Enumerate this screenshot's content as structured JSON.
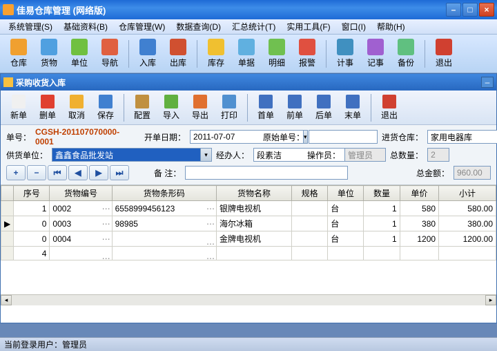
{
  "window": {
    "title": "佳易仓库管理 (网络版)"
  },
  "menu": [
    "系统管理(S)",
    "基础资料(B)",
    "仓库管理(W)",
    "数据查询(D)",
    "汇总统计(T)",
    "实用工具(F)",
    "窗口(I)",
    "帮助(H)"
  ],
  "main_toolbar": [
    {
      "label": "仓库",
      "color": "#f0a030"
    },
    {
      "label": "货物",
      "color": "#50a0e0"
    },
    {
      "label": "单位",
      "color": "#70c040"
    },
    {
      "label": "导航",
      "color": "#e06040"
    },
    {
      "label": "入库",
      "color": "#4080d0",
      "sep_before": true
    },
    {
      "label": "出库",
      "color": "#d05030"
    },
    {
      "label": "库存",
      "color": "#f0c030",
      "sep_before": true
    },
    {
      "label": "单据",
      "color": "#60b0e0"
    },
    {
      "label": "明细",
      "color": "#70c050"
    },
    {
      "label": "报警",
      "color": "#e05040"
    },
    {
      "label": "计事",
      "color": "#4090c0",
      "sep_before": true
    },
    {
      "label": "记事",
      "color": "#a060d0"
    },
    {
      "label": "备份",
      "color": "#60c080"
    },
    {
      "label": "退出",
      "color": "#d04030",
      "sep_before": true
    }
  ],
  "child": {
    "title": "采购收货入库",
    "toolbar": [
      {
        "label": "新单",
        "color": "#f0f0f0"
      },
      {
        "label": "删单",
        "color": "#e04030"
      },
      {
        "label": "取消",
        "color": "#f0b030"
      },
      {
        "label": "保存",
        "color": "#4080d0"
      },
      {
        "label": "配置",
        "color": "#c09040",
        "sep_before": true
      },
      {
        "label": "导入",
        "color": "#60b040"
      },
      {
        "label": "导出",
        "color": "#e07030"
      },
      {
        "label": "打印",
        "color": "#5090d0"
      },
      {
        "label": "首单",
        "color": "#4070c0",
        "sep_before": true
      },
      {
        "label": "前单",
        "color": "#4070c0"
      },
      {
        "label": "后单",
        "color": "#4070c0"
      },
      {
        "label": "末单",
        "color": "#4070c0"
      },
      {
        "label": "退出",
        "color": "#d04030",
        "sep_before": true
      }
    ],
    "form": {
      "bill_no_label": "单号：",
      "bill_no": "CGSH-201107070000-0001",
      "open_date_label": "开单日期：",
      "open_date": "2011-07-07",
      "orig_no_label": "原始单号：",
      "orig_no": "",
      "in_wh_label": "进货仓库：",
      "in_wh": "家用电器库",
      "supplier_label": "供货单位：",
      "supplier": "鑫鑫食品批发站",
      "handler_label": "经办人：",
      "handler": "段素洁",
      "operator_label": "操作员：",
      "operator": "管理员",
      "total_qty_label": "总数量：",
      "total_qty": "2",
      "remark_label": "备 注：",
      "remark": "",
      "total_amt_label": "总金额：",
      "total_amt": "960.00"
    },
    "grid": {
      "headers": [
        "序号",
        "货物编号",
        "货物条形码",
        "货物名称",
        "规格",
        "单位",
        "数量",
        "单价",
        "小计"
      ],
      "rows": [
        {
          "mark": "",
          "seq": "1",
          "code": "0002",
          "barcode": "6558999456123",
          "name": "银牌电视机",
          "spec": "",
          "unit": "台",
          "qty": "1",
          "price": "580",
          "subtotal": "580.00"
        },
        {
          "mark": "▶",
          "seq": "0",
          "code": "0003",
          "barcode": "98985",
          "name": "海尔冰箱",
          "spec": "",
          "unit": "台",
          "qty": "1",
          "price": "380",
          "subtotal": "380.00"
        },
        {
          "mark": "",
          "seq": "0",
          "code": "0004",
          "barcode": "",
          "name": "金牌电视机",
          "spec": "",
          "unit": "台",
          "qty": "1",
          "price": "1200",
          "subtotal": "1200.00"
        },
        {
          "mark": "",
          "seq": "4",
          "code": "",
          "barcode": "",
          "name": "",
          "spec": "",
          "unit": "",
          "qty": "",
          "price": "",
          "subtotal": ""
        }
      ]
    }
  },
  "status": {
    "user_label": "当前登录用户：",
    "user": "管理员"
  }
}
